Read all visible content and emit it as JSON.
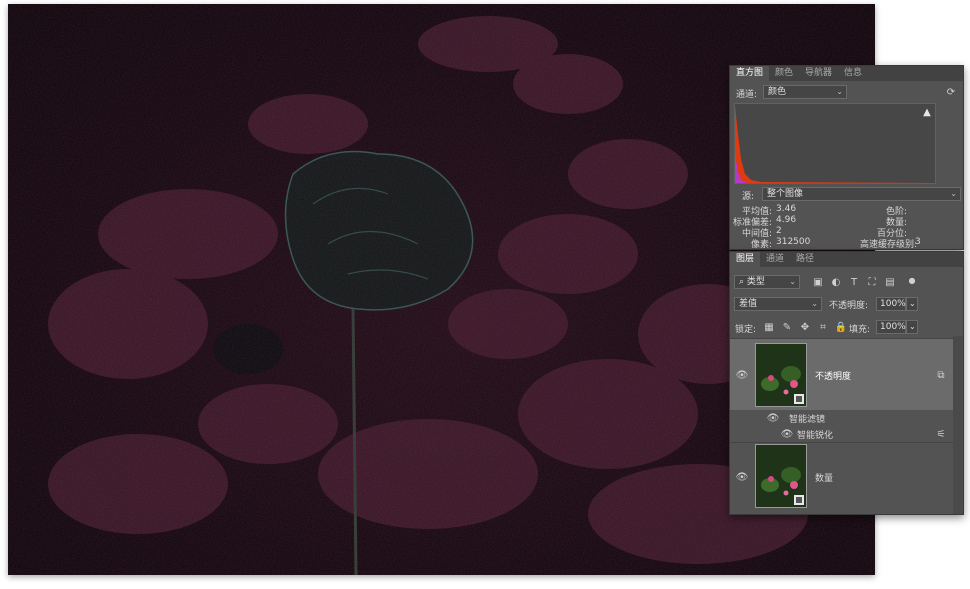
{
  "histogram": {
    "tabs": [
      "直方图",
      "颜色",
      "导航器",
      "信息"
    ],
    "channel_label": "通道:",
    "channel_value": "颜色",
    "source_label": "源:",
    "source_value": "整个图像",
    "warning_icon": "warning-triangle",
    "refresh_icon": "refresh-icon",
    "stats_left": [
      {
        "label": "平均值:",
        "value": "3.46"
      },
      {
        "label": "标准偏差:",
        "value": "4.96"
      },
      {
        "label": "中间值:",
        "value": "2"
      },
      {
        "label": "像素:",
        "value": "312500"
      }
    ],
    "stats_right": [
      {
        "label": "色阶:",
        "value": ""
      },
      {
        "label": "数量:",
        "value": ""
      },
      {
        "label": "百分位:",
        "value": ""
      },
      {
        "label": "高速缓存级别:",
        "value": "3"
      }
    ]
  },
  "layers": {
    "tabs": [
      "图层",
      "通道",
      "路径"
    ],
    "filter_kind": "类型",
    "blend_mode": "差值",
    "opacity_label": "不透明度:",
    "opacity_value": "100%",
    "lock_label": "锁定:",
    "fill_label": "填充:",
    "fill_value": "100%",
    "items": [
      {
        "name": "不透明度",
        "selected": true
      },
      {
        "name": "智能滤镜"
      },
      {
        "name": "智能锐化"
      },
      {
        "name": "数量",
        "selected": false
      }
    ]
  },
  "colors": {
    "panel_bg": "#535353",
    "tab_bar": "#424242",
    "selected_row": "#6b6b6b",
    "histogram_red": "#e03a12",
    "histogram_magenta": "#b13dc6"
  }
}
